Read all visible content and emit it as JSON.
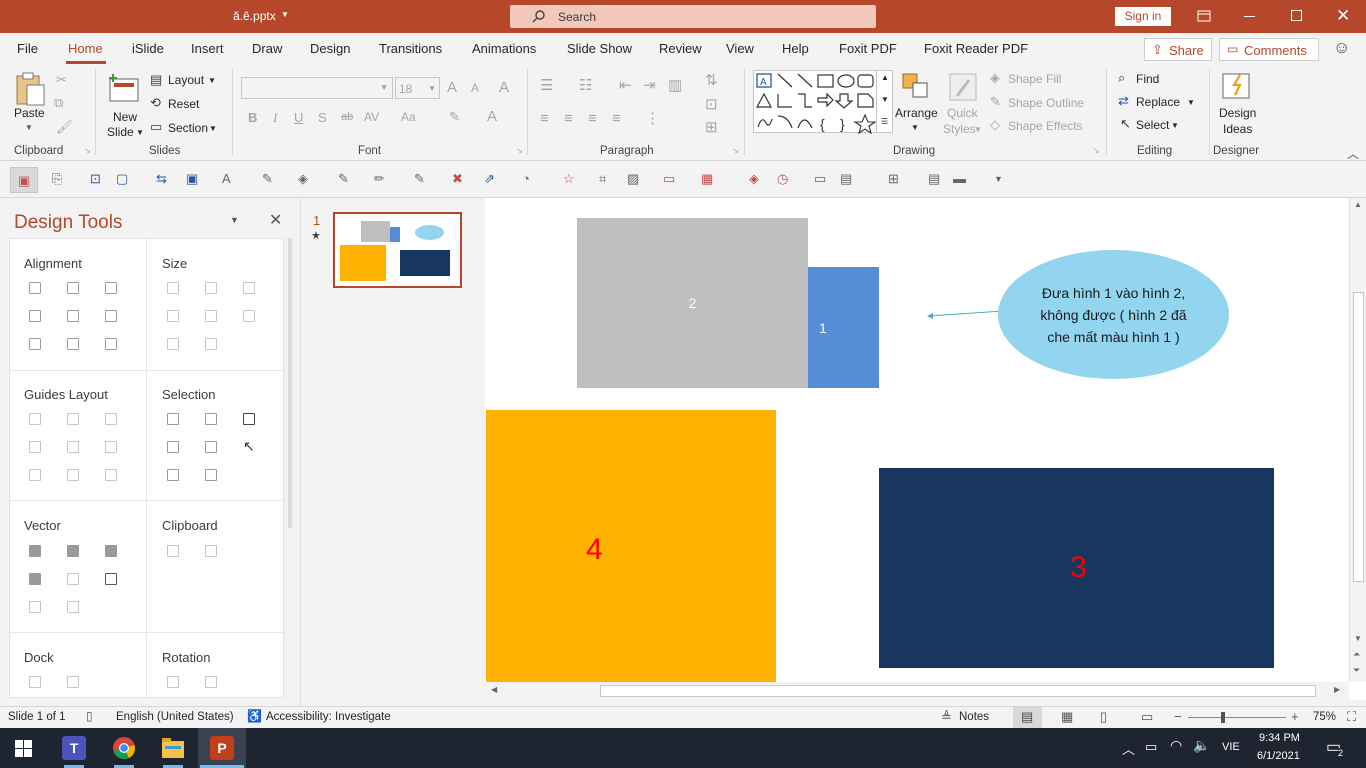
{
  "title": {
    "filename": "ă.ê.pptx",
    "search": "Search",
    "signin": "Sign in"
  },
  "tabs": [
    "File",
    "Home",
    "iSlide",
    "Insert",
    "Draw",
    "Design",
    "Transitions",
    "Animations",
    "Slide Show",
    "Review",
    "View",
    "Help",
    "Foxit PDF",
    "Foxit Reader PDF"
  ],
  "share": "Share",
  "comments": "Comments",
  "ribbon": {
    "paste": "Paste",
    "new_slide": "New",
    "new_slide2": "Slide",
    "layout": "Layout",
    "reset": "Reset",
    "section": "Section",
    "font_size": "18",
    "arrange": "Arrange",
    "quick_styles": "Quick",
    "quick_styles2": "Styles",
    "shape_fill": "Shape Fill",
    "shape_outline": "Shape Outline",
    "shape_effects": "Shape Effects",
    "find": "Find",
    "replace": "Replace",
    "select": "Select",
    "design_ideas": "Design",
    "design_ideas2": "Ideas",
    "groups": {
      "clipboard": "Clipboard",
      "slides": "Slides",
      "font": "Font",
      "paragraph": "Paragraph",
      "drawing": "Drawing",
      "editing": "Editing",
      "designer": "Designer"
    }
  },
  "design_tools": {
    "title": "Design Tools",
    "sections": {
      "alignment": "Alignment",
      "size": "Size",
      "guides": "Guides Layout",
      "selection": "Selection",
      "vector": "Vector",
      "clipboard": "Clipboard",
      "dock": "Dock",
      "rotation": "Rotation"
    }
  },
  "thumbnail": {
    "number": "1",
    "star": "★"
  },
  "slide": {
    "shape1": "1",
    "shape2": "2",
    "shape3": "3",
    "shape4": "4",
    "callout": "Đưa hình 1 vào hình 2, không được ( hình 2 đã che mất màu hình 1 )"
  },
  "status": {
    "slide": "Slide 1 of 1",
    "language": "English (United States)",
    "accessibility": "Accessibility: Investigate",
    "notes": "Notes",
    "zoom": "75%"
  },
  "taskbar": {
    "time": "9:34 PM",
    "date": "6/1/2021",
    "lang": "VIE",
    "notif": "2"
  },
  "colors": {
    "accent": "#b7472a",
    "shape_gray": "#bfbfbf",
    "shape_blue": "#558ed5",
    "shape_orange": "#ffb300",
    "shape_navy": "#17375e",
    "callout": "#93d5ef",
    "number_red": "#ff0000"
  }
}
